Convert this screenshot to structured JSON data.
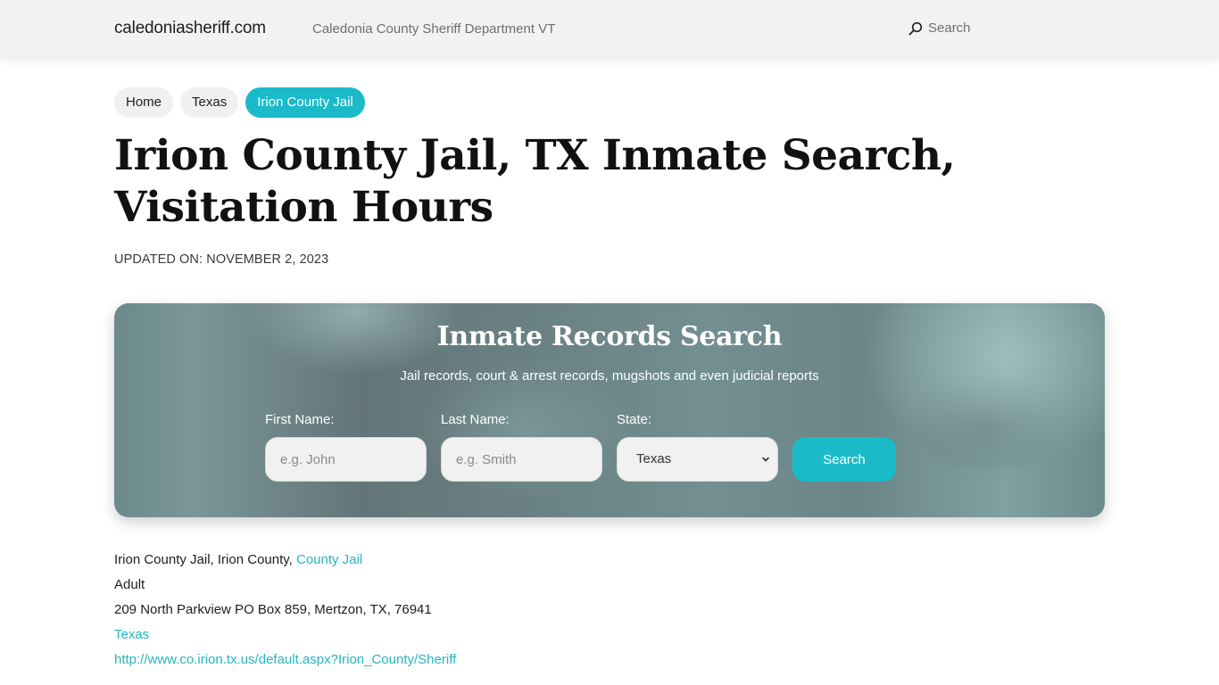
{
  "header": {
    "site_name": "caledoniasheriff.com",
    "tagline": "Caledonia County Sheriff Department VT",
    "search_label": "Search"
  },
  "breadcrumb": [
    {
      "label": "Home",
      "active": false
    },
    {
      "label": "Texas",
      "active": false
    },
    {
      "label": "Irion County Jail",
      "active": true
    }
  ],
  "page": {
    "title": "Irion County Jail, TX Inmate Search, Visitation Hours",
    "updated": "UPDATED ON: NOVEMBER 2, 2023"
  },
  "search_panel": {
    "title": "Inmate Records Search",
    "subtitle": "Jail records, court & arrest records, mugshots and even judicial reports",
    "first_name_label": "First Name:",
    "first_name_placeholder": "e.g. John",
    "first_name_value": "",
    "last_name_label": "Last Name:",
    "last_name_placeholder": "e.g. Smith",
    "last_name_value": "",
    "state_label": "State:",
    "state_selected": "Texas",
    "button_label": "Search"
  },
  "info": {
    "facility_prefix": "Irion County Jail, Irion County, ",
    "facility_type_link": "County Jail",
    "category": "Adult",
    "address": "209 North Parkview PO Box 859, Mertzon, TX, 76941",
    "state_link": "Texas",
    "website_link": "http://www.co.irion.tx.us/default.aspx?Irion_County/Sheriff"
  },
  "colors": {
    "accent": "#1bbac9",
    "link": "#27b5c2",
    "header_bg": "#f2f2f2"
  }
}
